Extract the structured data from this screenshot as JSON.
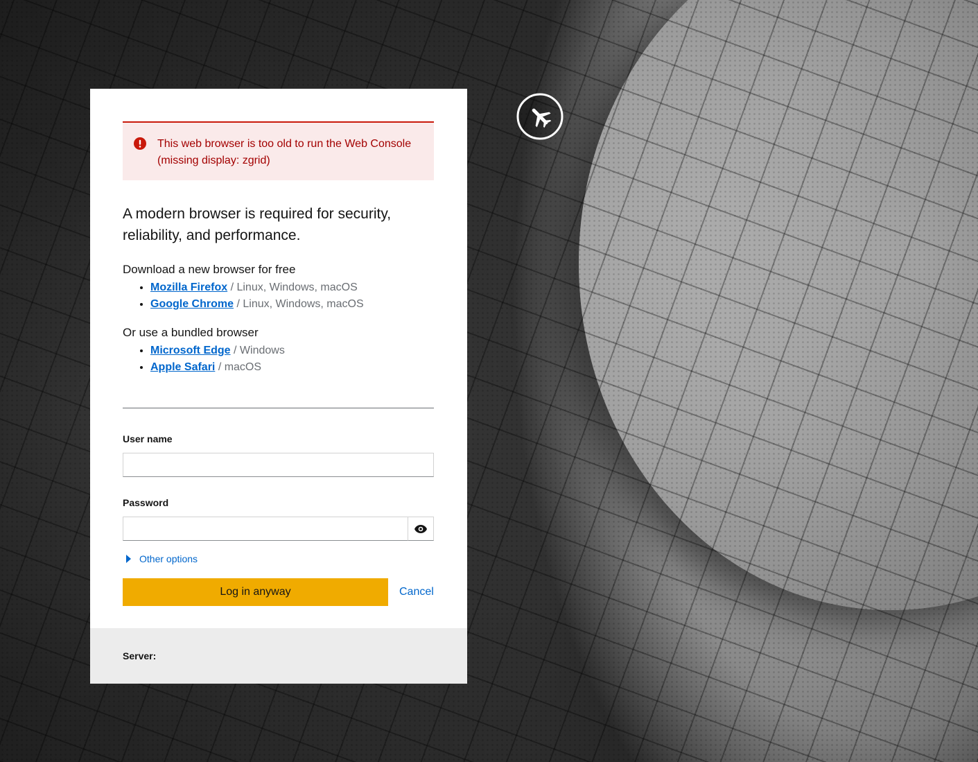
{
  "alert": {
    "message": "This web browser is too old to run the Web Console (missing display: zgrid)",
    "icon": "exclamation-circle-icon",
    "color": "#c9190b"
  },
  "headline": "A modern browser is required for security, reliability, and performance.",
  "download_section": {
    "title": "Download a new browser for free",
    "items": [
      {
        "name": "Mozilla Firefox",
        "platforms": "/ Linux, Windows, macOS"
      },
      {
        "name": "Google Chrome",
        "platforms": "/ Linux, Windows, macOS"
      }
    ]
  },
  "bundled_section": {
    "title": "Or use a bundled browser",
    "items": [
      {
        "name": "Microsoft Edge",
        "platforms": "/ Windows"
      },
      {
        "name": "Apple Safari",
        "platforms": "/ macOS"
      }
    ]
  },
  "login": {
    "username_label": "User name",
    "username_value": "",
    "password_label": "Password",
    "password_value": "",
    "show_password_icon": "eye-icon",
    "other_options": "Other options",
    "login_button": "Log in anyway",
    "cancel_button": "Cancel"
  },
  "footer": {
    "server_label": "Server:",
    "server_value": ""
  },
  "brand": {
    "icon": "airplane-logo-icon"
  },
  "colors": {
    "accent": "#0066cc",
    "login_button": "#f0ab00",
    "alert_background": "#faeaea",
    "alert_text": "#a30000"
  }
}
